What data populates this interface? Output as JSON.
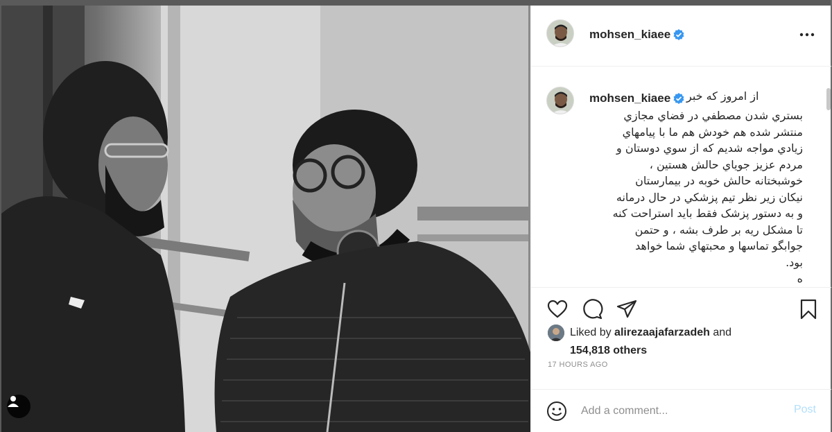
{
  "post": {
    "author": "mohsen_kiaee",
    "verified": true,
    "caption_first_line": "از امروز که خبر",
    "caption_lines": [
      "بستري شدن مصطفي در فضاي مجازي",
      "منتشر شده هم خودش هم ما با پيامهاي",
      "زيادي مواجه شديم که از سوي دوستان و",
      "مردم عزيز جوياي حالش هستين ،",
      "خوشبختانه حالش خوبه در بيمارستان",
      "نيکان زير نظر تيم پزشکي در حال درمانه",
      "و به دستور پزشک فقط بايد استراحت کنه",
      "تا مشکل ريه بر طرف بشه ، و حتمن",
      "جوابگو تماسها و محبتهاي شما خواهد",
      "بود.",
      "ه"
    ],
    "likes_prefix": "Liked by ",
    "liked_by_user": "alirezaajafarzadeh",
    "likes_and": " and",
    "likes_others": "154,818 others",
    "timestamp": "17 HOURS AGO"
  },
  "comment": {
    "placeholder": "Add a comment...",
    "post_label": "Post"
  },
  "icons": {
    "like": "heart-icon",
    "comment": "comment-icon",
    "share": "paper-plane-icon",
    "save": "bookmark-icon",
    "more": "more-horizontal-icon",
    "emoji": "smiley-icon",
    "tag": "user-tag-icon",
    "verified": "verified-badge-icon"
  },
  "colors": {
    "verified_blue": "#3897f0",
    "post_button_disabled": "#b2dffc",
    "secondary_text": "#8e8e8e"
  }
}
